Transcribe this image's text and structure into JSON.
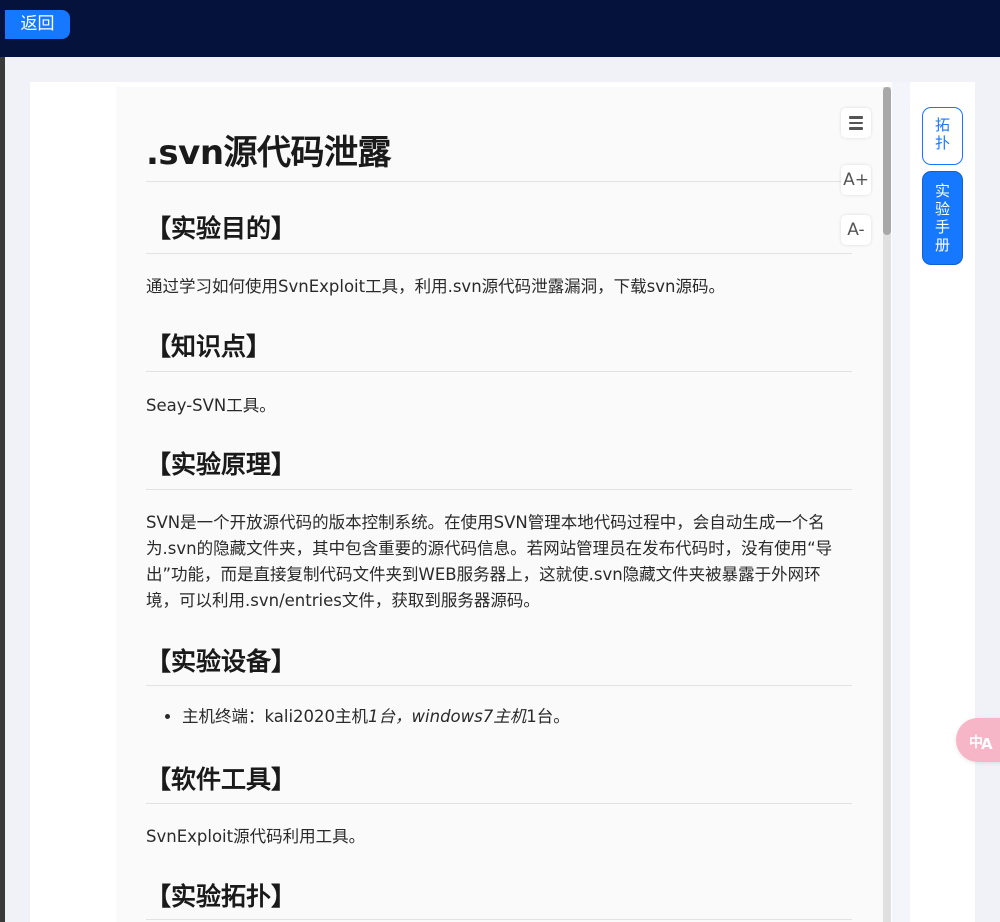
{
  "topbar": {
    "back_label": "返回"
  },
  "toolbar": {
    "font_up": "A+",
    "font_down": "A-",
    "menu_icon": "hamburger-menu-icon"
  },
  "side_tabs": {
    "topology": [
      "拓",
      "扑"
    ],
    "manual": [
      "实",
      "验",
      "手",
      "册"
    ]
  },
  "doc": {
    "title": ".svn源代码泄露",
    "sections": [
      {
        "heading": "【实验目的】",
        "body": "通过学习如何使用SvnExploit工具，利用.svn源代码泄露漏洞，下载svn源码。"
      },
      {
        "heading": "【知识点】",
        "body": "Seay-SVN工具。"
      },
      {
        "heading": "【实验原理】",
        "body": "SVN是一个开放源代码的版本控制系统。在使用SVN管理本地代码过程中，会自动生成一个名为.svn的隐藏文件夹，其中包含重要的源代码信息。若网站管理员在发布代码时，没有使用“导出”功能，而是直接复制代码文件夹到WEB服务器上，这就使.svn隐藏文件夹被暴露于外网环境，可以利用.svn/entries文件，获取到服务器源码。"
      },
      {
        "heading": "【实验设备】",
        "list_item": {
          "prefix": "主机终端：kali2020主机",
          "em1": "1台，windows7主机",
          "suffix": "1台。"
        }
      },
      {
        "heading": "【软件工具】",
        "body": "SvnExploit源代码利用工具。"
      },
      {
        "heading": "【实验拓扑】"
      }
    ]
  },
  "colors": {
    "topbar": "#04123c",
    "accent": "#1677ff",
    "translate_button": "#f7b6c8"
  }
}
